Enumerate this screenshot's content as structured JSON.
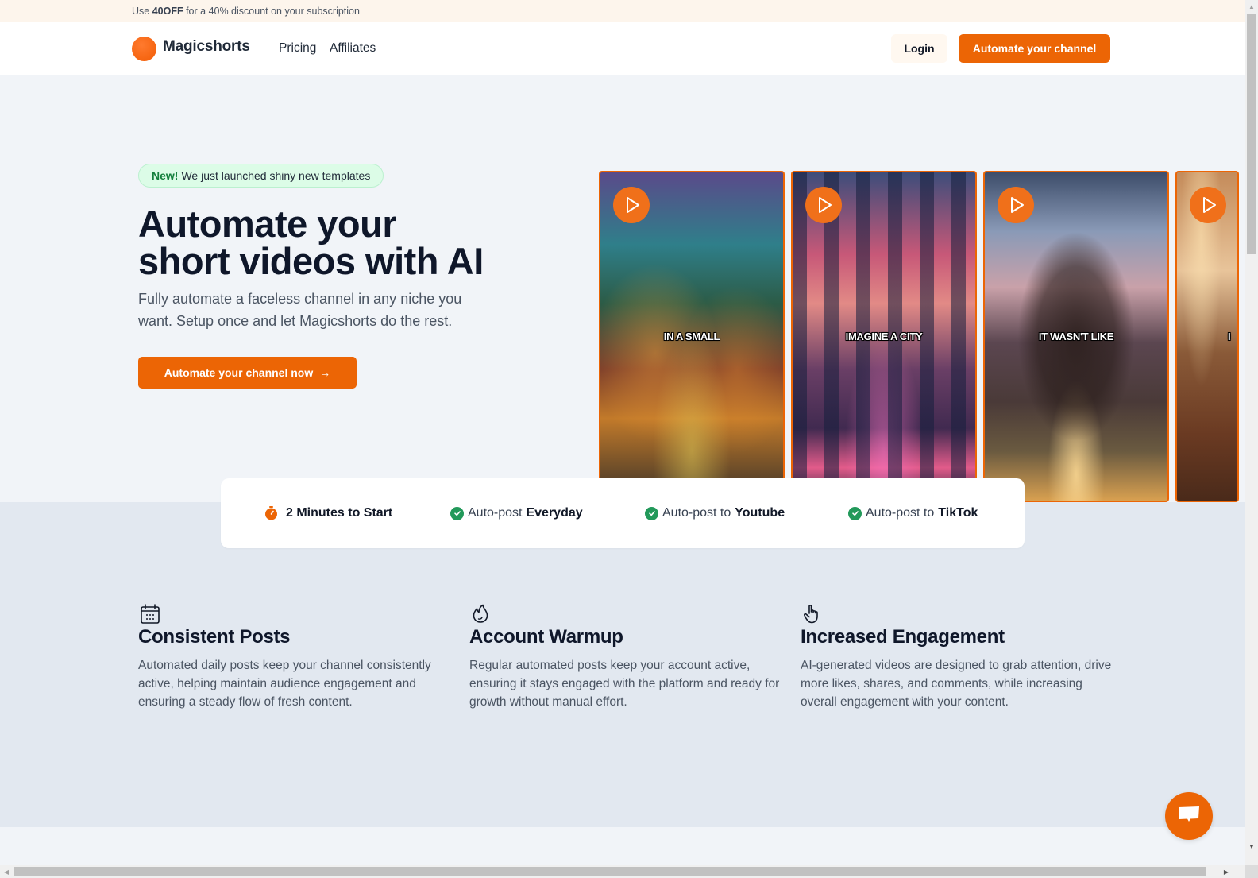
{
  "promo": {
    "prefix": "Use ",
    "code": "40OFF",
    "suffix": " for a 40% discount on your subscription"
  },
  "header": {
    "brand": "Magicshorts",
    "nav": [
      {
        "label": "Pricing"
      },
      {
        "label": "Affiliates"
      }
    ],
    "login_label": "Login",
    "cta_label": "Automate your channel"
  },
  "hero": {
    "badge_new": "New!",
    "badge_text": "We just launched shiny new templates",
    "title_line1": "Automate your",
    "title_line2": "short videos with AI",
    "subtitle": "Fully automate a faceless channel in any niche you want. Setup once and let Magicshorts do the rest.",
    "cta_label": "Automate your channel now",
    "cta_icon": "arrow-right-icon"
  },
  "videos": [
    {
      "caption": "IN A SMALL",
      "icon": "play-icon"
    },
    {
      "caption": "IMAGINE A CITY",
      "icon": "play-icon"
    },
    {
      "caption": "IT WASN'T LIKE",
      "icon": "play-icon"
    },
    {
      "caption": "I",
      "icon": "play-icon"
    }
  ],
  "stats": [
    {
      "icon": "timer-icon",
      "prefix": "",
      "bold": "2 Minutes to Start"
    },
    {
      "icon": "check-circle-icon",
      "prefix": "Auto-post ",
      "bold": "Everyday"
    },
    {
      "icon": "check-circle-icon",
      "prefix": "Auto-post to ",
      "bold": "Youtube"
    },
    {
      "icon": "check-circle-icon",
      "prefix": "Auto-post to ",
      "bold": "TikTok"
    }
  ],
  "features": [
    {
      "icon": "calendar-icon",
      "title": "Consistent Posts",
      "desc": "Automated daily posts keep your channel consistently active, helping maintain audience engagement and ensuring a steady flow of fresh content."
    },
    {
      "icon": "flame-icon",
      "title": "Account Warmup",
      "desc": "Regular automated posts keep your account active, ensuring it stays engaged with the platform and ready for growth without manual effort."
    },
    {
      "icon": "hand-pointer-icon",
      "title": "Increased Engagement",
      "desc": "AI-generated videos are designed to grab attention, drive more likes, shares, and comments, while increasing overall engagement with your content."
    }
  ],
  "colors": {
    "brand_orange": "#ec6505",
    "check_green": "#22995a",
    "badge_green_bg": "#dcfce7",
    "badge_green_text": "#15803d",
    "promo_bg": "#fdf5ec"
  },
  "chat": {
    "icon": "chat-bubble-icon"
  }
}
